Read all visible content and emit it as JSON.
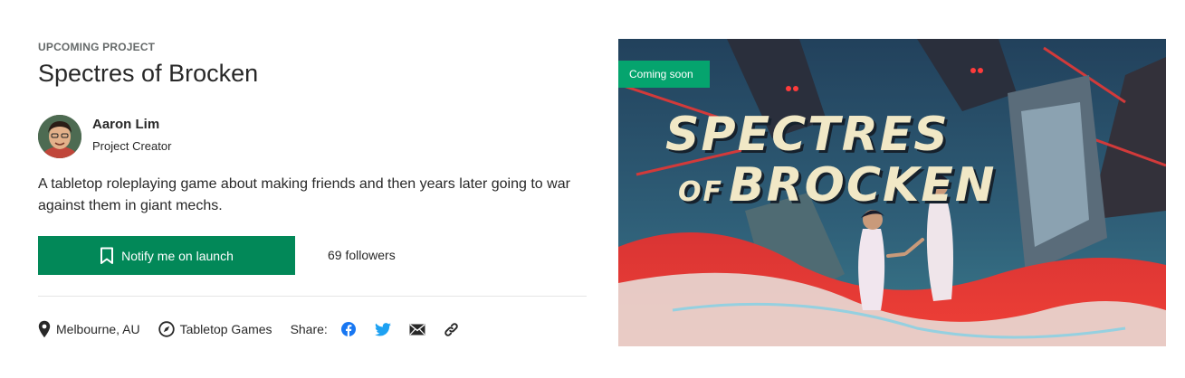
{
  "project": {
    "eyebrow": "UPCOMING PROJECT",
    "title": "Spectres of Brocken",
    "blurb": "A tabletop roleplaying game about making friends and then years later going to war against them in giant mechs."
  },
  "creator": {
    "name": "Aaron Lim",
    "role": "Project Creator"
  },
  "actions": {
    "notify_label": "Notify me on launch",
    "followers": "69 followers"
  },
  "meta": {
    "location": "Melbourne, AU",
    "category": "Tabletop Games",
    "share_label": "Share:",
    "share_icons": [
      "facebook-icon",
      "twitter-icon",
      "email-icon",
      "link-icon"
    ]
  },
  "hero": {
    "badge": "Coming soon",
    "art_title_line1": "SPECTRES",
    "art_title_of": "OF",
    "art_title_line2": "BROCKEN"
  },
  "colors": {
    "brand_green": "#028858",
    "badge_green": "#05a46e",
    "text": "#282828",
    "muted": "#656969",
    "facebook": "#1877f2",
    "twitter": "#1da1f2"
  }
}
